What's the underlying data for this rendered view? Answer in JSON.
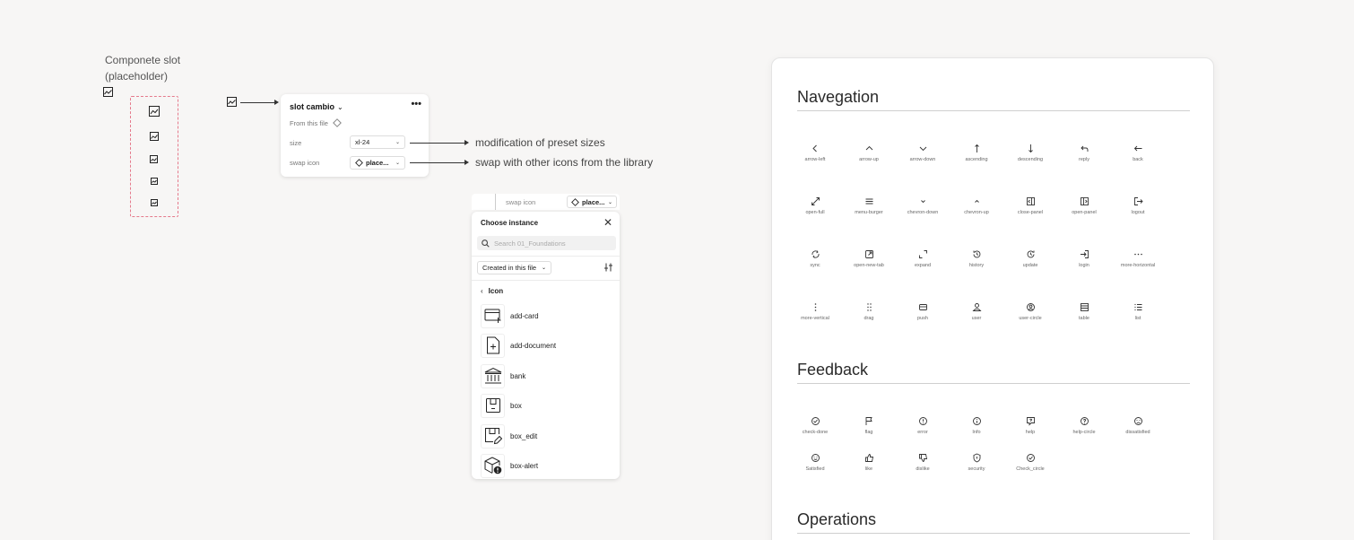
{
  "slot": {
    "caption_line1": "Componete slot",
    "caption_line2": "(placeholder)"
  },
  "props_panel": {
    "title": "slot cambio",
    "subtitle": "From this file",
    "size_label": "size",
    "size_value": "xl-24",
    "swap_label": "swap icon",
    "swap_value": "place..."
  },
  "annotations": {
    "size": "modification of preset sizes",
    "swap": "swap with other icons from the library"
  },
  "picker": {
    "top_label": "swap icon",
    "top_value": "place...",
    "title": "Choose instance",
    "search_placeholder": "Search 01_Foundations",
    "filter": "Created in this file",
    "back_label": "Icon",
    "items": [
      {
        "label": "add-card",
        "icon": "add-card-icon"
      },
      {
        "label": "add-document",
        "icon": "add-document-icon"
      },
      {
        "label": "bank",
        "icon": "bank-icon"
      },
      {
        "label": "box",
        "icon": "box-icon"
      },
      {
        "label": "box_edit",
        "icon": "box-edit-icon"
      },
      {
        "label": "box-alert",
        "icon": "box-alert-icon"
      }
    ]
  },
  "doc": {
    "navigation_title": "Navegation",
    "feedback_title": "Feedback",
    "operations_title": "Operations",
    "navigation": [
      [
        "arrow-left",
        "arrow-up",
        "arrow-down",
        "ascending",
        "descending",
        "reply",
        "back"
      ],
      [
        "open-full",
        "menu-burger",
        "chevron-down",
        "chevron-up",
        "close-panel",
        "open-panel",
        "logout"
      ],
      [
        "sync",
        "open-new-tab",
        "expand",
        "history",
        "update",
        "login",
        "more-horizontal"
      ],
      [
        "more-vertical",
        "drag",
        "push",
        "user",
        "user-circle",
        "table",
        "list"
      ]
    ],
    "feedback": [
      [
        "check-done",
        "flag",
        "error",
        "Info",
        "help",
        "help-circle",
        "dissatisfied"
      ],
      [
        "Satisfied",
        "like",
        "dislike",
        "security",
        "Check_circle"
      ]
    ]
  }
}
